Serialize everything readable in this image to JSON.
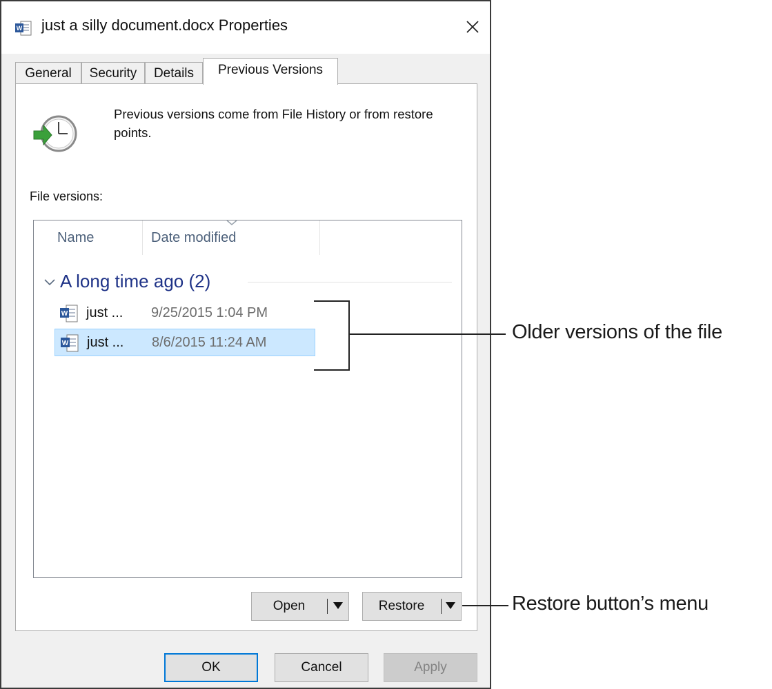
{
  "dialog": {
    "title": "just a silly document.docx Properties",
    "close_glyph": "✕"
  },
  "tabs": [
    {
      "label": "General",
      "active": false
    },
    {
      "label": "Security",
      "active": false
    },
    {
      "label": "Details",
      "active": false
    },
    {
      "label": "Previous Versions",
      "active": true
    }
  ],
  "info": {
    "text": "Previous versions come from File History or from restore points.",
    "icon": "restore-clock-icon"
  },
  "file_versions": {
    "label": "File versions:",
    "columns": [
      "Name",
      "Date modified"
    ],
    "group": "A long time ago (2)",
    "rows": [
      {
        "name": "just ...",
        "date": "9/25/2015 1:04 PM",
        "selected": false
      },
      {
        "name": "just ...",
        "date": "8/6/2015 11:24 AM",
        "selected": true
      }
    ]
  },
  "actions": {
    "open_label": "Open",
    "restore_label": "Restore"
  },
  "footer": {
    "ok_label": "OK",
    "cancel_label": "Cancel",
    "apply_label": "Apply"
  },
  "callouts": {
    "older_versions": "Older versions of the file",
    "restore_menu": "Restore button’s menu"
  },
  "colors": {
    "selection": "#cce8ff",
    "group_header": "#1e3287",
    "default_button_border": "#0078d7",
    "word_icon_blue": "#2b579a"
  }
}
